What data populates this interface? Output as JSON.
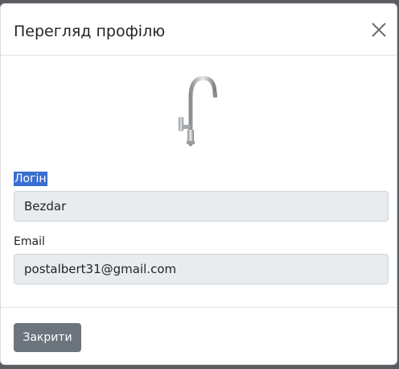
{
  "modal": {
    "title": "Перегляд профілю",
    "close_icon": "close-icon"
  },
  "profile": {
    "image_icon": "faucet-image",
    "login_label": "Логін",
    "login_value": "Bezdar",
    "email_label": "Email",
    "email_value": "postalbert31@gmail.com"
  },
  "footer": {
    "close_button_label": "Закрити"
  },
  "colors": {
    "backdrop": "#5a5c5f",
    "input_bg": "#e9ecef",
    "button_bg": "#6c757d",
    "selection_highlight": "#3a6ed0"
  }
}
